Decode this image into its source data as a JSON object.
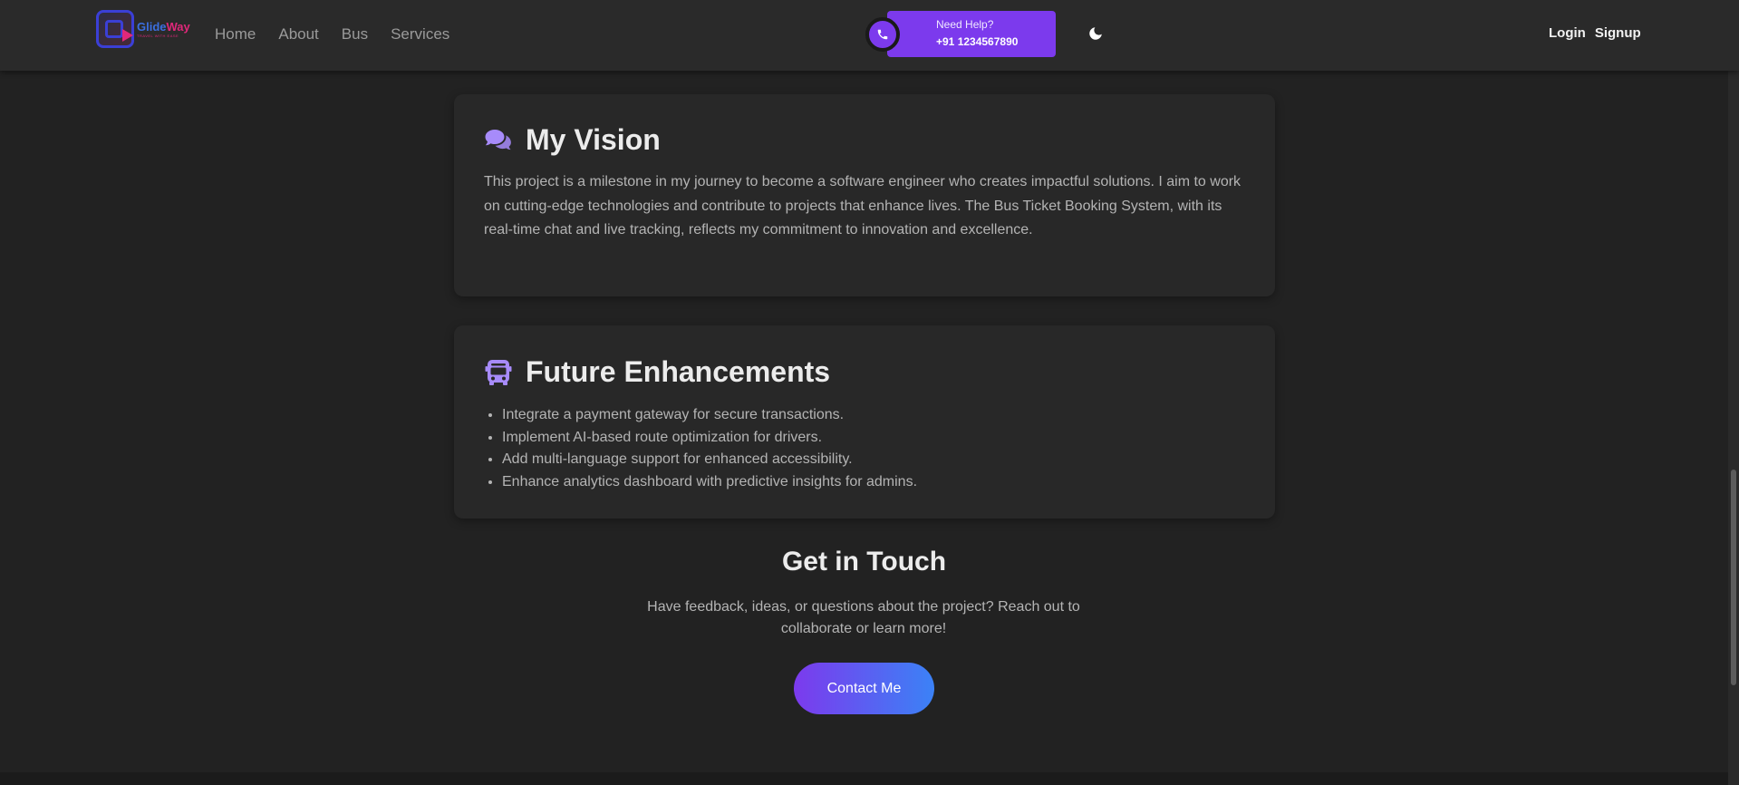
{
  "header": {
    "logo": {
      "name_part1": "Glide",
      "name_part2": "Way",
      "tagline": "TRAVEL WITH EASE",
      "icon": "bus-arrow-logo"
    },
    "nav": [
      {
        "label": "Home"
      },
      {
        "label": "About"
      },
      {
        "label": "Bus"
      },
      {
        "label": "Services"
      }
    ],
    "help": {
      "label": "Need Help?",
      "phone": "+91 1234567890",
      "icon": "phone-icon",
      "color": "#7c3aed"
    },
    "theme_toggle": {
      "icon": "moon-icon"
    },
    "auth": {
      "login": "Login",
      "signup": "Signup"
    }
  },
  "vision": {
    "icon": "comments-icon",
    "title": "My Vision",
    "text": "This project is a milestone in my journey to become a software engineer who creates impactful solutions. I aim to work on cutting-edge technologies and contribute to projects that enhance lives. The Bus Ticket Booking System, with its real-time chat and live tracking, reflects my commitment to innovation and excellence."
  },
  "future": {
    "icon": "bus-icon",
    "title": "Future Enhancements",
    "items": [
      "Integrate a payment gateway for secure transactions.",
      "Implement AI-based route optimization for drivers.",
      "Add multi-language support for enhanced accessibility.",
      "Enhance analytics dashboard with predictive insights for admins."
    ]
  },
  "touch": {
    "title": "Get in Touch",
    "text": "Have feedback, ideas, or questions about the project? Reach out to collaborate or learn more!",
    "button": "Contact Me"
  },
  "colors": {
    "accent": "#7c3aed",
    "accent_icon": "#a78bfa",
    "gradient_end": "#3b82f6",
    "background": "#222222"
  }
}
